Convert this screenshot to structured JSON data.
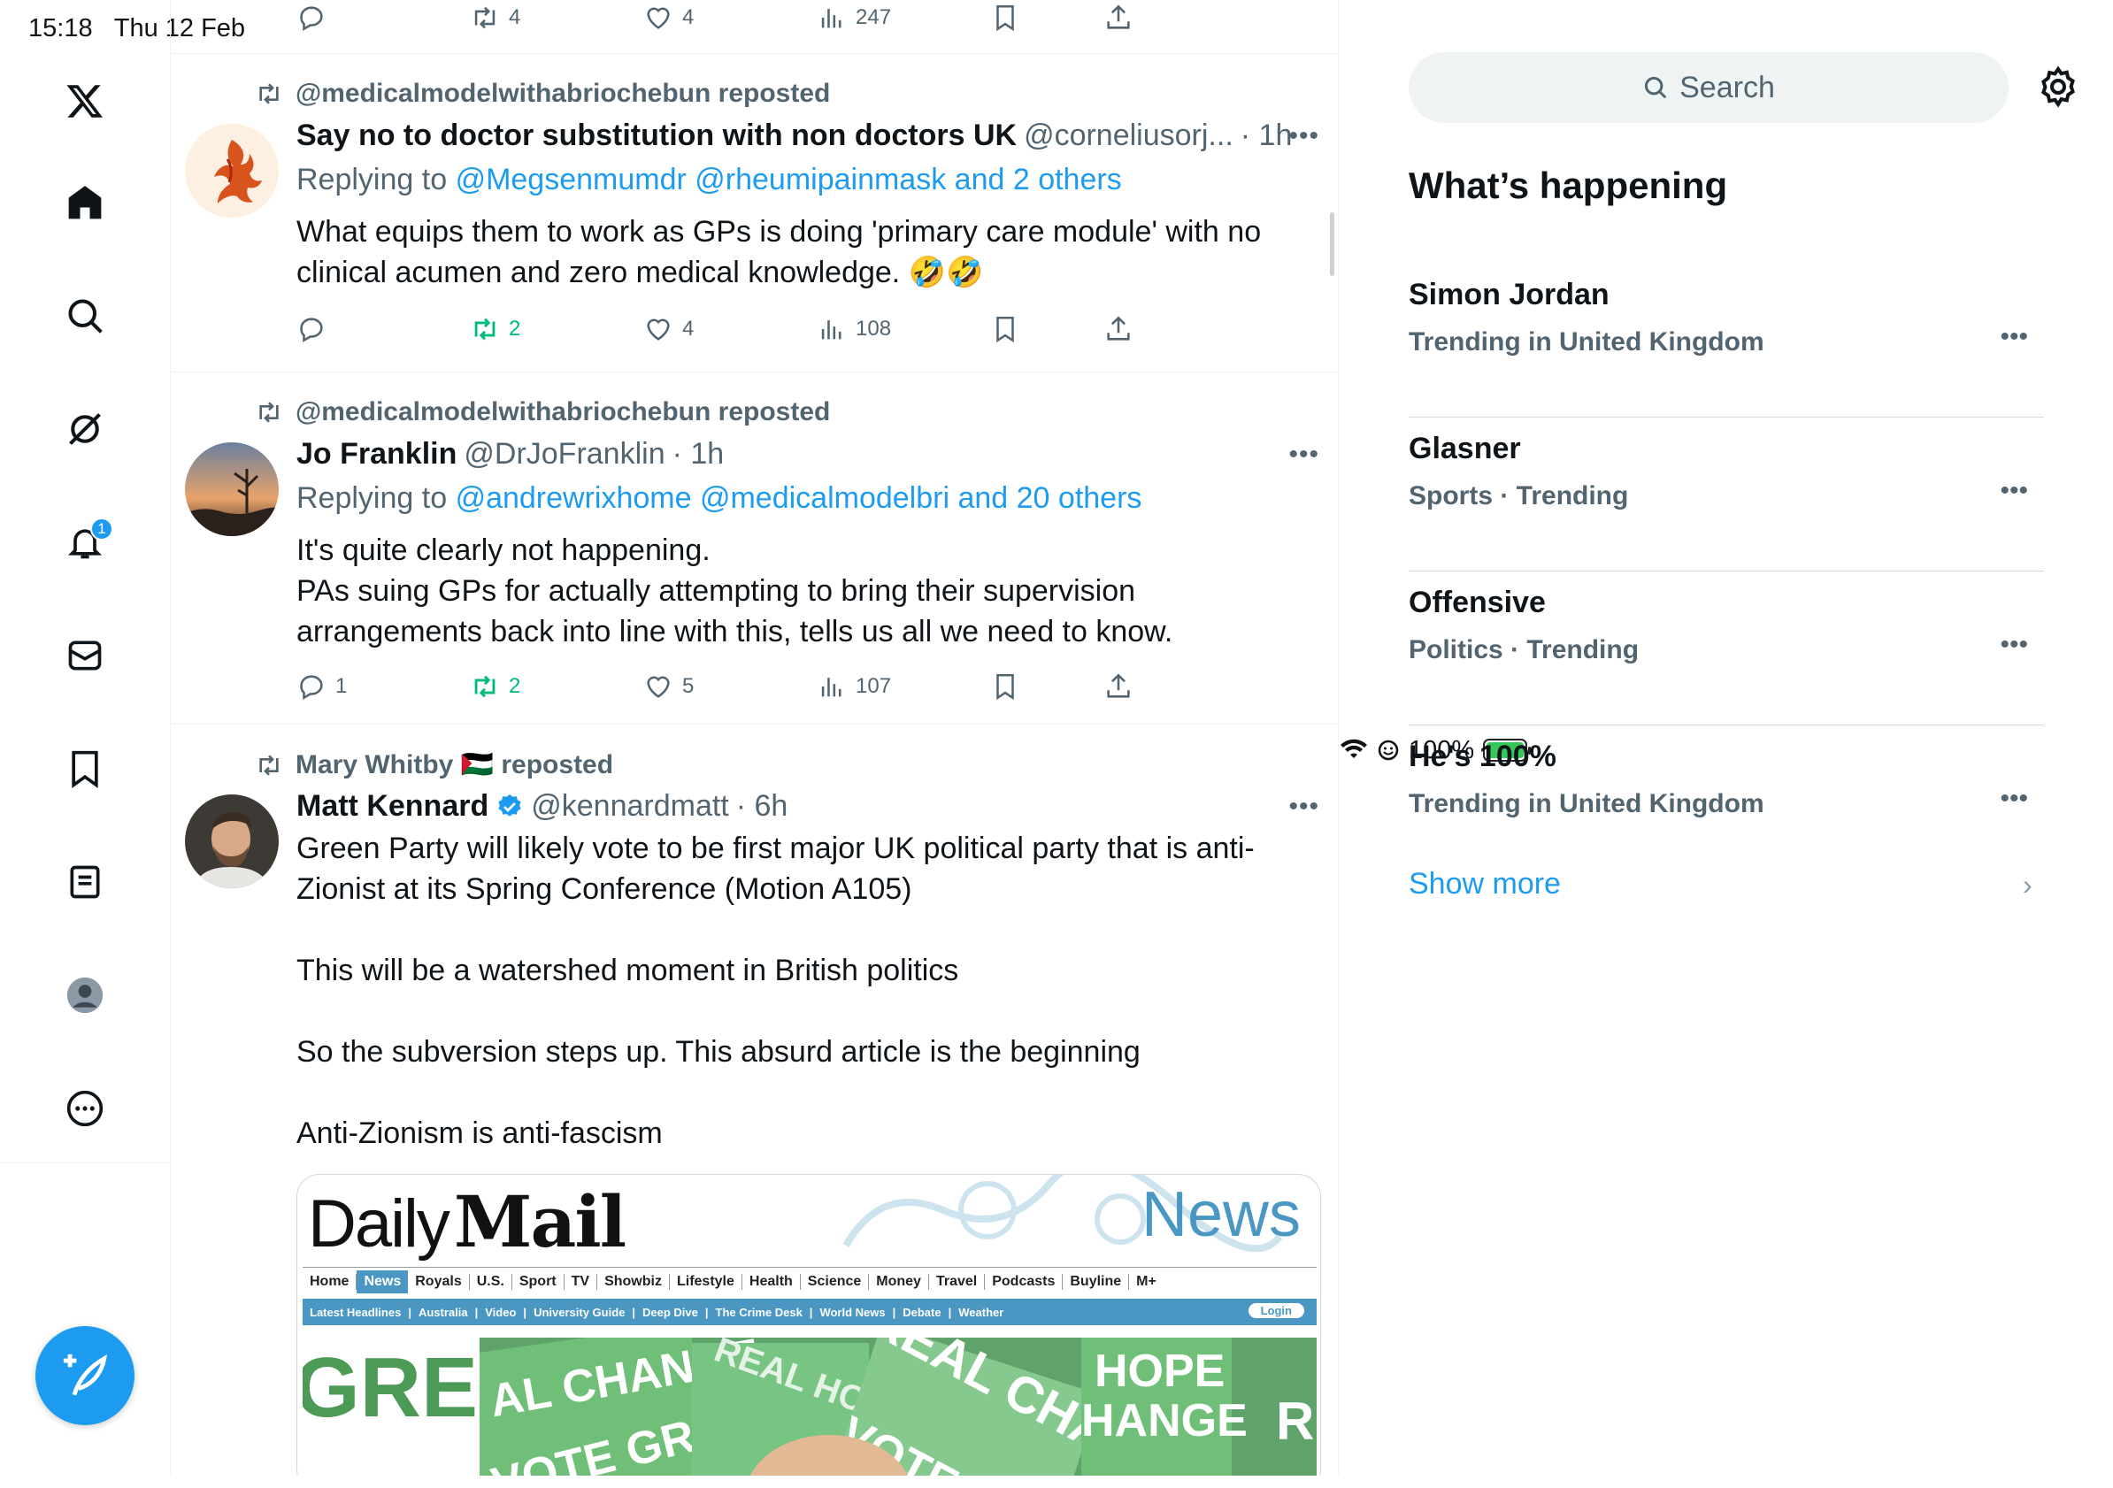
{
  "status_bar": {
    "time": "15:18",
    "date": "Thu 12 Feb",
    "battery": "100%"
  },
  "sidebar": {
    "items": [
      "x-logo",
      "home",
      "explore",
      "grok",
      "notifications",
      "messages",
      "bookmarks",
      "lists",
      "profile",
      "more"
    ],
    "notification_count": "1"
  },
  "top_actions": {
    "retweets": "4",
    "likes": "4",
    "views": "247"
  },
  "tweets": [
    {
      "repost_by": "@medicalmodelwithabriochebun reposted",
      "name": "Say no to doctor substitution with non doctors UK",
      "handle": "@corneliusorj...",
      "time": "· 1h",
      "reply_prefix": "Replying to",
      "reply_to": "@Megsenmumdr @rheumipainmask and 2 others",
      "text": "What equips them to work as GPs is doing 'primary care module' with no clinical acumen and zero medical knowledge. 🤣🤣",
      "replies": "",
      "retweets": "2",
      "likes": "4",
      "views": "108"
    },
    {
      "repost_by": "@medicalmodelwithabriochebun reposted",
      "name": "Jo Franklin",
      "handle": "@DrJoFranklin",
      "time": "· 1h",
      "reply_prefix": "Replying to",
      "reply_to": "@andrewrixhome @medicalmodelbri and 20 others",
      "text": "It's quite clearly not happening.\nPAs suing GPs for actually attempting to bring their supervision arrangements back into line with this, tells us all we need to know.",
      "replies": "1",
      "retweets": "2",
      "likes": "5",
      "views": "107"
    },
    {
      "repost_by": "Mary Whitby 🇵🇸 reposted",
      "name": "Matt Kennard",
      "handle": "@kennardmatt",
      "time": "· 6h",
      "text": "Green Party will likely vote to be first major UK political party that is anti-Zionist at its Spring Conference (Motion A105)\n\nThis will be a watershed moment in British politics\n\nSo the subversion steps up. This absurd article is the beginning\n\nAnti-Zionism is anti-fascism"
    }
  ],
  "card": {
    "logo_left": "Daily",
    "logo_right": "Mail",
    "section": "News",
    "nav": [
      "Home",
      "News",
      "Royals",
      "U.S.",
      "Sport",
      "TV",
      "Showbiz",
      "Lifestyle",
      "Health",
      "Science",
      "Money",
      "Travel",
      "Podcasts",
      "Buyline",
      "M+"
    ],
    "subnav": [
      "Latest Headlines",
      "Australia",
      "Video",
      "University Guide",
      "Deep Dive",
      "The Crime Desk",
      "World News",
      "Debate",
      "Weather"
    ],
    "login": "Login",
    "placards": [
      "GREEN",
      "AL CHANGE",
      "VOTE GREEN",
      "REAL HOPE",
      "REAL CHANGE",
      "VOTE G",
      "HOPE",
      "HANGE",
      "RE"
    ]
  },
  "right": {
    "search_placeholder": "Search",
    "heading": "What’s happening",
    "trends": [
      {
        "title": "Simon Jordan",
        "context": "Trending in United Kingdom"
      },
      {
        "title": "Glasner",
        "context": "Sports · Trending"
      },
      {
        "title": "Offensive",
        "context": "Politics · Trending"
      },
      {
        "title": "He's 100%",
        "context": "Trending in United Kingdom"
      }
    ],
    "show_more": "Show more"
  },
  "colors": {
    "accent": "#1d9bf0",
    "retweet_green": "#00ba7c",
    "muted": "#536471"
  }
}
